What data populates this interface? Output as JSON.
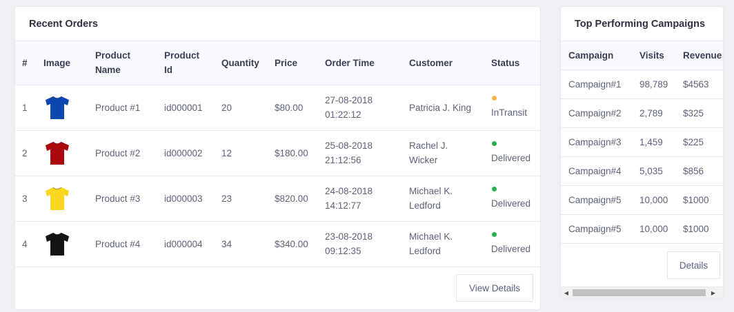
{
  "orders": {
    "title": "Recent Orders",
    "columns": {
      "num": "#",
      "image": "Image",
      "product_name": [
        "Product",
        "Name"
      ],
      "product_id": [
        "Product",
        "Id"
      ],
      "quantity": "Quantity",
      "price": "Price",
      "order_time": "Order Time",
      "customer": "Customer",
      "status": "Status"
    },
    "rows": [
      {
        "num": "1",
        "image": "blue-tshirt",
        "image_color": "#0d47b0",
        "name": "Product #1",
        "id": "id000001",
        "quantity": "20",
        "price": "$80.00",
        "date": "27-08-2018",
        "time": "01:22:12",
        "customer_line1": "Patricia J. King",
        "customer_line2": "",
        "status": "InTransit",
        "status_color": "#f5b942"
      },
      {
        "num": "2",
        "image": "red-tshirt",
        "image_color": "#a9070d",
        "name": "Product #2",
        "id": "id000002",
        "quantity": "12",
        "price": "$180.00",
        "date": "25-08-2018",
        "time": "21:12:56",
        "customer_line1": "Rachel J.",
        "customer_line2": "Wicker",
        "status": "Delivered",
        "status_color": "#21b04b"
      },
      {
        "num": "3",
        "image": "yellow-tshirt",
        "image_color": "#fbd61e",
        "name": "Product #3",
        "id": "id000003",
        "quantity": "23",
        "price": "$820.00",
        "date": "24-08-2018",
        "time": "14:12:77",
        "customer_line1": "Michael K.",
        "customer_line2": "Ledford",
        "status": "Delivered",
        "status_color": "#21b04b"
      },
      {
        "num": "4",
        "image": "black-tshirt",
        "image_color": "#141414",
        "name": "Product #4",
        "id": "id000004",
        "quantity": "34",
        "price": "$340.00",
        "date": "23-08-2018",
        "time": "09:12:35",
        "customer_line1": "Michael K.",
        "customer_line2": "Ledford",
        "status": "Delivered",
        "status_color": "#21b04b"
      }
    ],
    "view_details_label": "View Details"
  },
  "campaigns": {
    "title": "Top Performing Campaigns",
    "columns": {
      "campaign": "Campaign",
      "visits": "Visits",
      "revenue": "Revenue"
    },
    "rows": [
      {
        "campaign": "Campaign#1",
        "visits": "98,789",
        "revenue": "$4563"
      },
      {
        "campaign": "Campaign#2",
        "visits": "2,789",
        "revenue": "$325"
      },
      {
        "campaign": "Campaign#3",
        "visits": "1,459",
        "revenue": "$225"
      },
      {
        "campaign": "Campaign#4",
        "visits": "5,035",
        "revenue": "$856"
      },
      {
        "campaign": "Campaign#5",
        "visits": "10,000",
        "revenue": "$1000"
      },
      {
        "campaign": "Campaign#5",
        "visits": "10,000",
        "revenue": "$1000"
      }
    ],
    "details_label": "Details",
    "scrollbar": {
      "left_arrow_icon": "triangle-left-icon",
      "right_arrow_icon": "triangle-right-icon"
    }
  }
}
